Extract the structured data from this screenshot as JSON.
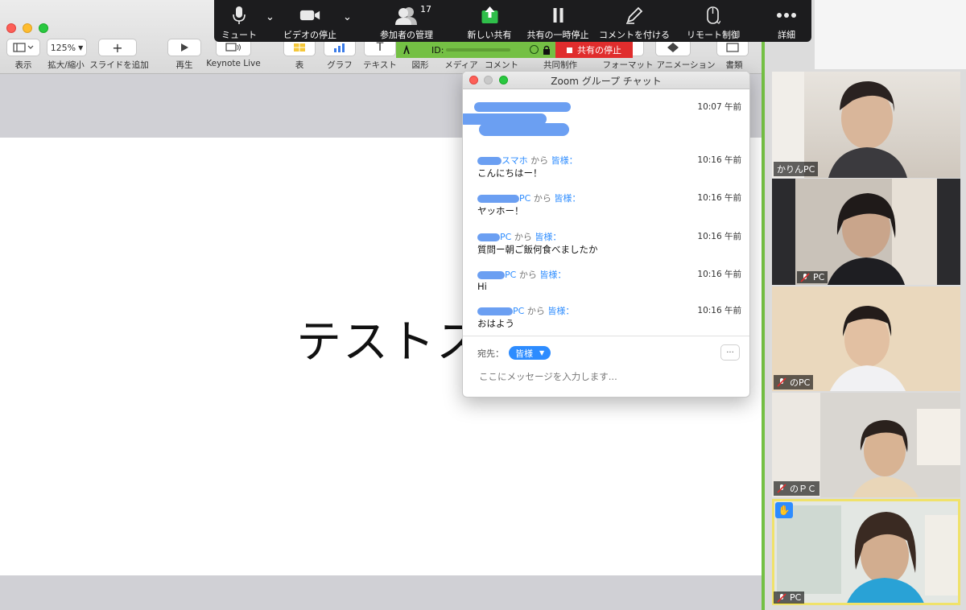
{
  "keynote": {
    "toolbar": {
      "view": "表示",
      "zoom_value": "125%",
      "zoom": "拡大/縮小",
      "add_slide": "スライドを追加",
      "play": "再生",
      "keynote_live": "Keynote Live",
      "table": "表",
      "chart": "グラフ",
      "text": "テキスト",
      "shape": "図形",
      "media": "メディア",
      "comment": "コメント",
      "collaborate": "共同制作",
      "format": "フォーマット",
      "animate": "アニメーション",
      "document": "書類"
    },
    "slide_title": "テストス"
  },
  "zoom_bar": {
    "mute": "ミュート",
    "stop_video": "ビデオの停止",
    "participants": "参加者の管理",
    "participants_count": "17",
    "new_share": "新しい共有",
    "pause_share": "共有の一時停止",
    "annotate": "コメントを付ける",
    "remote_control": "リモート制御",
    "more": "詳細"
  },
  "share_strip": {
    "id_label": "ID:",
    "stop_share": "共有の停止"
  },
  "chat": {
    "title": "Zoom グループ チャット",
    "first_time": "10:07 午前",
    "messages": [
      {
        "sender": "スマホ",
        "from": "から",
        "to": "皆様：",
        "time": "10:16 午前",
        "text": "こんにちはー！"
      },
      {
        "sender": "PC",
        "from": "から",
        "to": "皆様：",
        "time": "10:16 午前",
        "text": "ヤッホー！"
      },
      {
        "sender": "PC",
        "from": "から",
        "to": "皆様：",
        "time": "10:16 午前",
        "text": "質問ー朝ご飯何食べましたか"
      },
      {
        "sender": "PC",
        "from": "から",
        "to": "皆様：",
        "time": "10:16 午前",
        "text": "Hi"
      },
      {
        "sender": "PC",
        "from": "から",
        "to": "皆様：",
        "time": "10:16 午前",
        "text": "おはよう"
      }
    ],
    "to_label": "宛先：",
    "to_value": "皆様",
    "more": "···",
    "input_placeholder": "ここにメッセージを入力します..."
  },
  "gallery": [
    {
      "name": "かりんPC",
      "muted": false
    },
    {
      "name": "PC",
      "muted": true
    },
    {
      "name": "のPC",
      "muted": true
    },
    {
      "name": "のＰＣ",
      "muted": true
    },
    {
      "name": "PC",
      "muted": true,
      "hand_raised": true
    }
  ],
  "colors": {
    "zoom_blue": "#2d8cff",
    "share_green": "#74c044",
    "stop_red": "#e02d2d",
    "zoom_bar": "#1c1c1e",
    "active_speaker": "#f0e26a"
  }
}
